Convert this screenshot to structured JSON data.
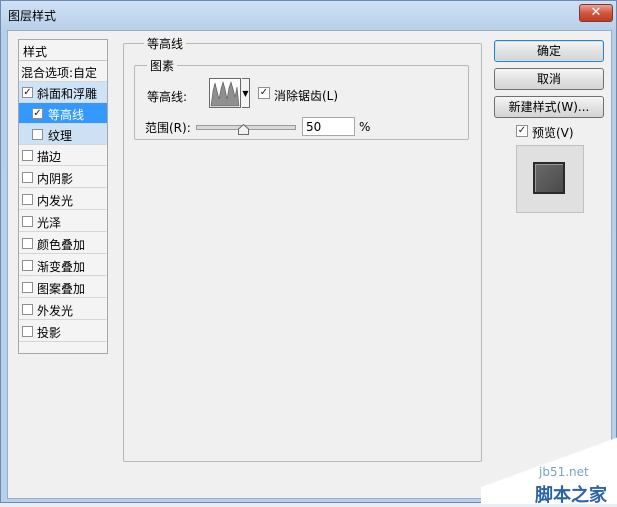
{
  "window": {
    "title": "图层样式",
    "close_glyph": "✕"
  },
  "style_list": {
    "header": "样式",
    "items": [
      {
        "label": "混合选项:自定",
        "checkbox": false
      },
      {
        "label": "斜面和浮雕",
        "checkbox": true,
        "checked": true
      },
      {
        "label": "等高线",
        "checkbox": true,
        "checked": true
      },
      {
        "label": "纹理",
        "checkbox": true,
        "checked": false
      },
      {
        "label": "描边",
        "checkbox": true,
        "checked": false
      },
      {
        "label": "内阴影",
        "checkbox": true,
        "checked": false
      },
      {
        "label": "内发光",
        "checkbox": true,
        "checked": false
      },
      {
        "label": "光泽",
        "checkbox": true,
        "checked": false
      },
      {
        "label": "颜色叠加",
        "checkbox": true,
        "checked": false
      },
      {
        "label": "渐变叠加",
        "checkbox": true,
        "checked": false
      },
      {
        "label": "图案叠加",
        "checkbox": true,
        "checked": false
      },
      {
        "label": "外发光",
        "checkbox": true,
        "checked": false
      },
      {
        "label": "投影",
        "checkbox": true,
        "checked": false
      }
    ]
  },
  "contour_panel": {
    "group_title": "等高线",
    "sub_title": "图素",
    "contour_label": "等高线:",
    "antialias_label": "消除锯齿(L)",
    "antialias_checked": true,
    "range_label": "范围(R):",
    "range_value": "50",
    "range_unit": "%",
    "range_percent": 50
  },
  "buttons": {
    "ok": "确定",
    "cancel": "取消",
    "new_style": "新建样式(W)...",
    "preview_label": "预览(V)",
    "preview_checked": true
  },
  "watermark": {
    "site": "jb51.net",
    "name": "脚本之家"
  },
  "colors": {
    "selection": "#3399ff",
    "title_bar": "#b9d0ea",
    "close": "#c23a22"
  }
}
